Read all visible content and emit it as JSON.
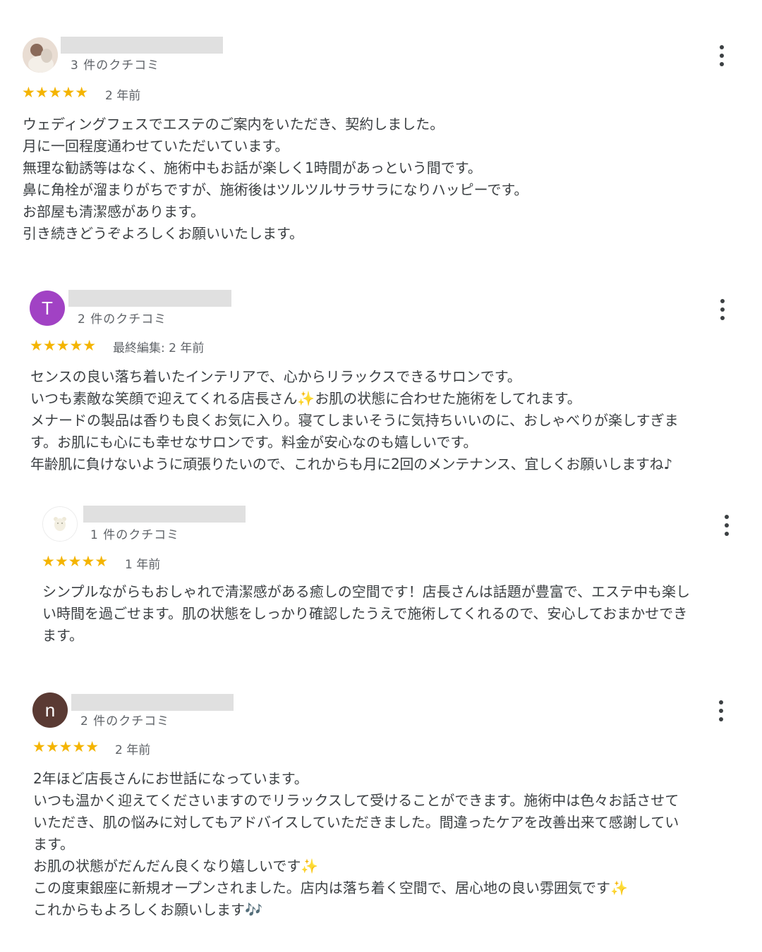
{
  "colors": {
    "star": "#f4b400",
    "text": "#3c4043",
    "meta": "#5f6368",
    "avatar_t": "#a142c4",
    "avatar_n": "#5a3a33",
    "redaction": "#e0e0e0"
  },
  "reviews": [
    {
      "count": "3 件のクチコミ",
      "stars": "★★★★★",
      "date": "2 年前",
      "lines": [
        "ウェディングフェスでエステのご案内をいただき、契約しました。",
        "月に一回程度通わせていただいています。",
        "無理な勧誘等はなく、施術中もお話が楽しく1時間があっという間です。",
        "鼻に角栓が溜まりがちですが、施術後はツルツルサラサラになりハッピーです。",
        "お部屋も清潔感があります。",
        "引き続きどうぞよろしくお願いいたします。"
      ]
    },
    {
      "avatar_letter": "T",
      "count": "2 件のクチコミ",
      "stars": "★★★★★",
      "date": "最終編集: 2 年前",
      "lines": [
        "センスの良い落ち着いたインテリアで、心からリラックスできるサロンです。",
        "いつも素敵な笑顔で迎えてくれる店長さん",
        "✨",
        "お肌の状態に合わせた施術をしてれます。",
        "メナードの製品は香りも良くお気に入り。寝てしまいそうに気持ちいいのに、おしゃべりが楽しすぎま",
        "す。お肌にも心にも幸せなサロンです。料金が安心なのも嬉しいです。",
        "年齢肌に負けないように頑張りたいので、これからも月に2回のメンテナンス、宜しくお願いしますね♪"
      ]
    },
    {
      "count": "1 件のクチコミ",
      "stars": "★★★★★",
      "date": "1 年前",
      "lines": [
        "シンプルながらもおしゃれで清潔感がある癒しの空間です！店長さんは話題が豊富で、エステ中も楽し",
        "い時間を過ごせます。肌の状態をしっかり確認したうえで施術してくれるので、安心しておまかせでき",
        "ます。"
      ]
    },
    {
      "avatar_letter": "n",
      "count": "2 件のクチコミ",
      "stars": "★★★★★",
      "date": "2 年前",
      "lines": [
        "2年ほど店長さんにお世話になっています。",
        "いつも温かく迎えてくださいますのでリラックスして受けることができます。施術中は色々お話させて",
        "いただき、肌の悩みに対してもアドバイスしていただきました。間違ったケアを改善出来て感謝してい",
        "ます。",
        "お肌の状態がだんだん良くなり嬉しいです",
        "✨",
        "この度東銀座に新規オープンされました。店内は落ち着く空間で、居心地の良い雰囲気です",
        "✨",
        "これからもよろしくお願いします",
        "🎶"
      ]
    }
  ]
}
